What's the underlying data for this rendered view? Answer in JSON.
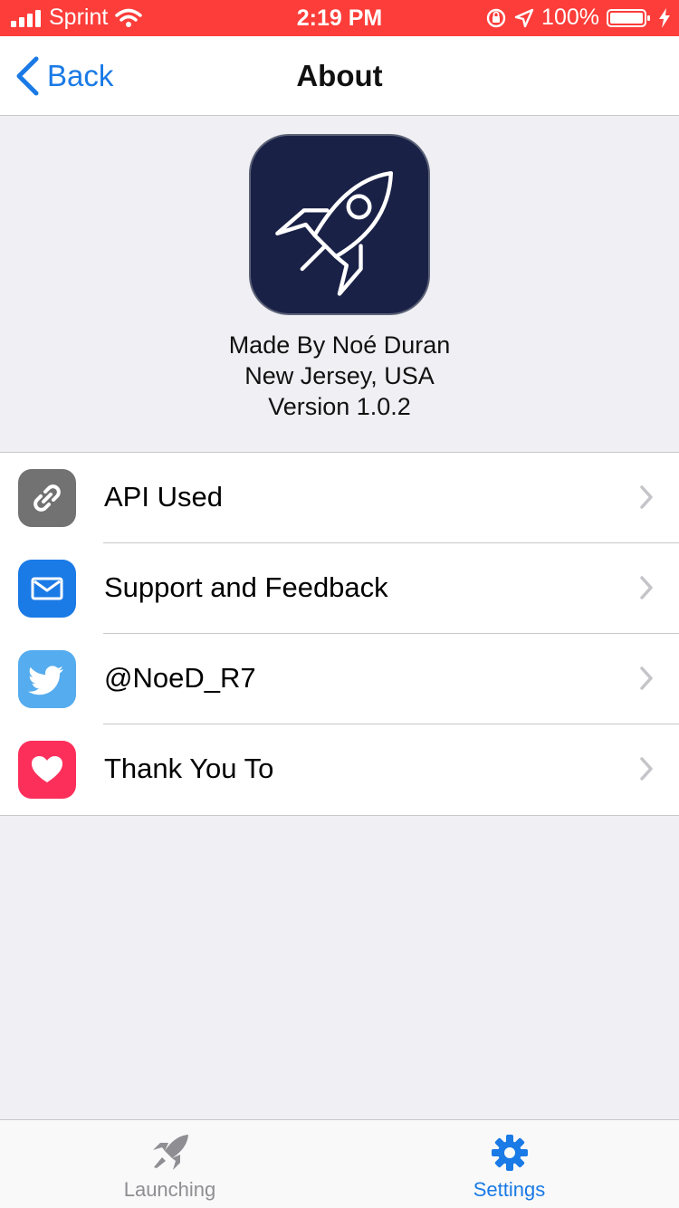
{
  "status_bar": {
    "carrier": "Sprint",
    "time": "2:19 PM",
    "battery": "100%"
  },
  "nav": {
    "back_label": "Back",
    "title": "About"
  },
  "app_info": {
    "icon": "rocket-icon",
    "made_by": "Made By Noé Duran",
    "location": "New Jersey, USA",
    "version": "Version 1.0.2"
  },
  "list": {
    "items": [
      {
        "label": "API Used",
        "icon": "link-icon",
        "color": "#727272"
      },
      {
        "label": "Support and Feedback",
        "icon": "mail-icon",
        "color": "#1a7ae6"
      },
      {
        "label": "@NoeD_R7",
        "icon": "twitter-icon",
        "color": "#55acee"
      },
      {
        "label": "Thank You To",
        "icon": "heart-icon",
        "color": "#fc2f5b"
      }
    ]
  },
  "tabbar": {
    "tabs": [
      {
        "label": "Launching",
        "icon": "rocket-icon",
        "selected": false
      },
      {
        "label": "Settings",
        "icon": "gear-icon",
        "selected": true
      }
    ]
  },
  "colors": {
    "status_bar_bg": "#fc3d39",
    "accent": "#1a7ae6",
    "tab_inactive": "#8e8e93"
  }
}
